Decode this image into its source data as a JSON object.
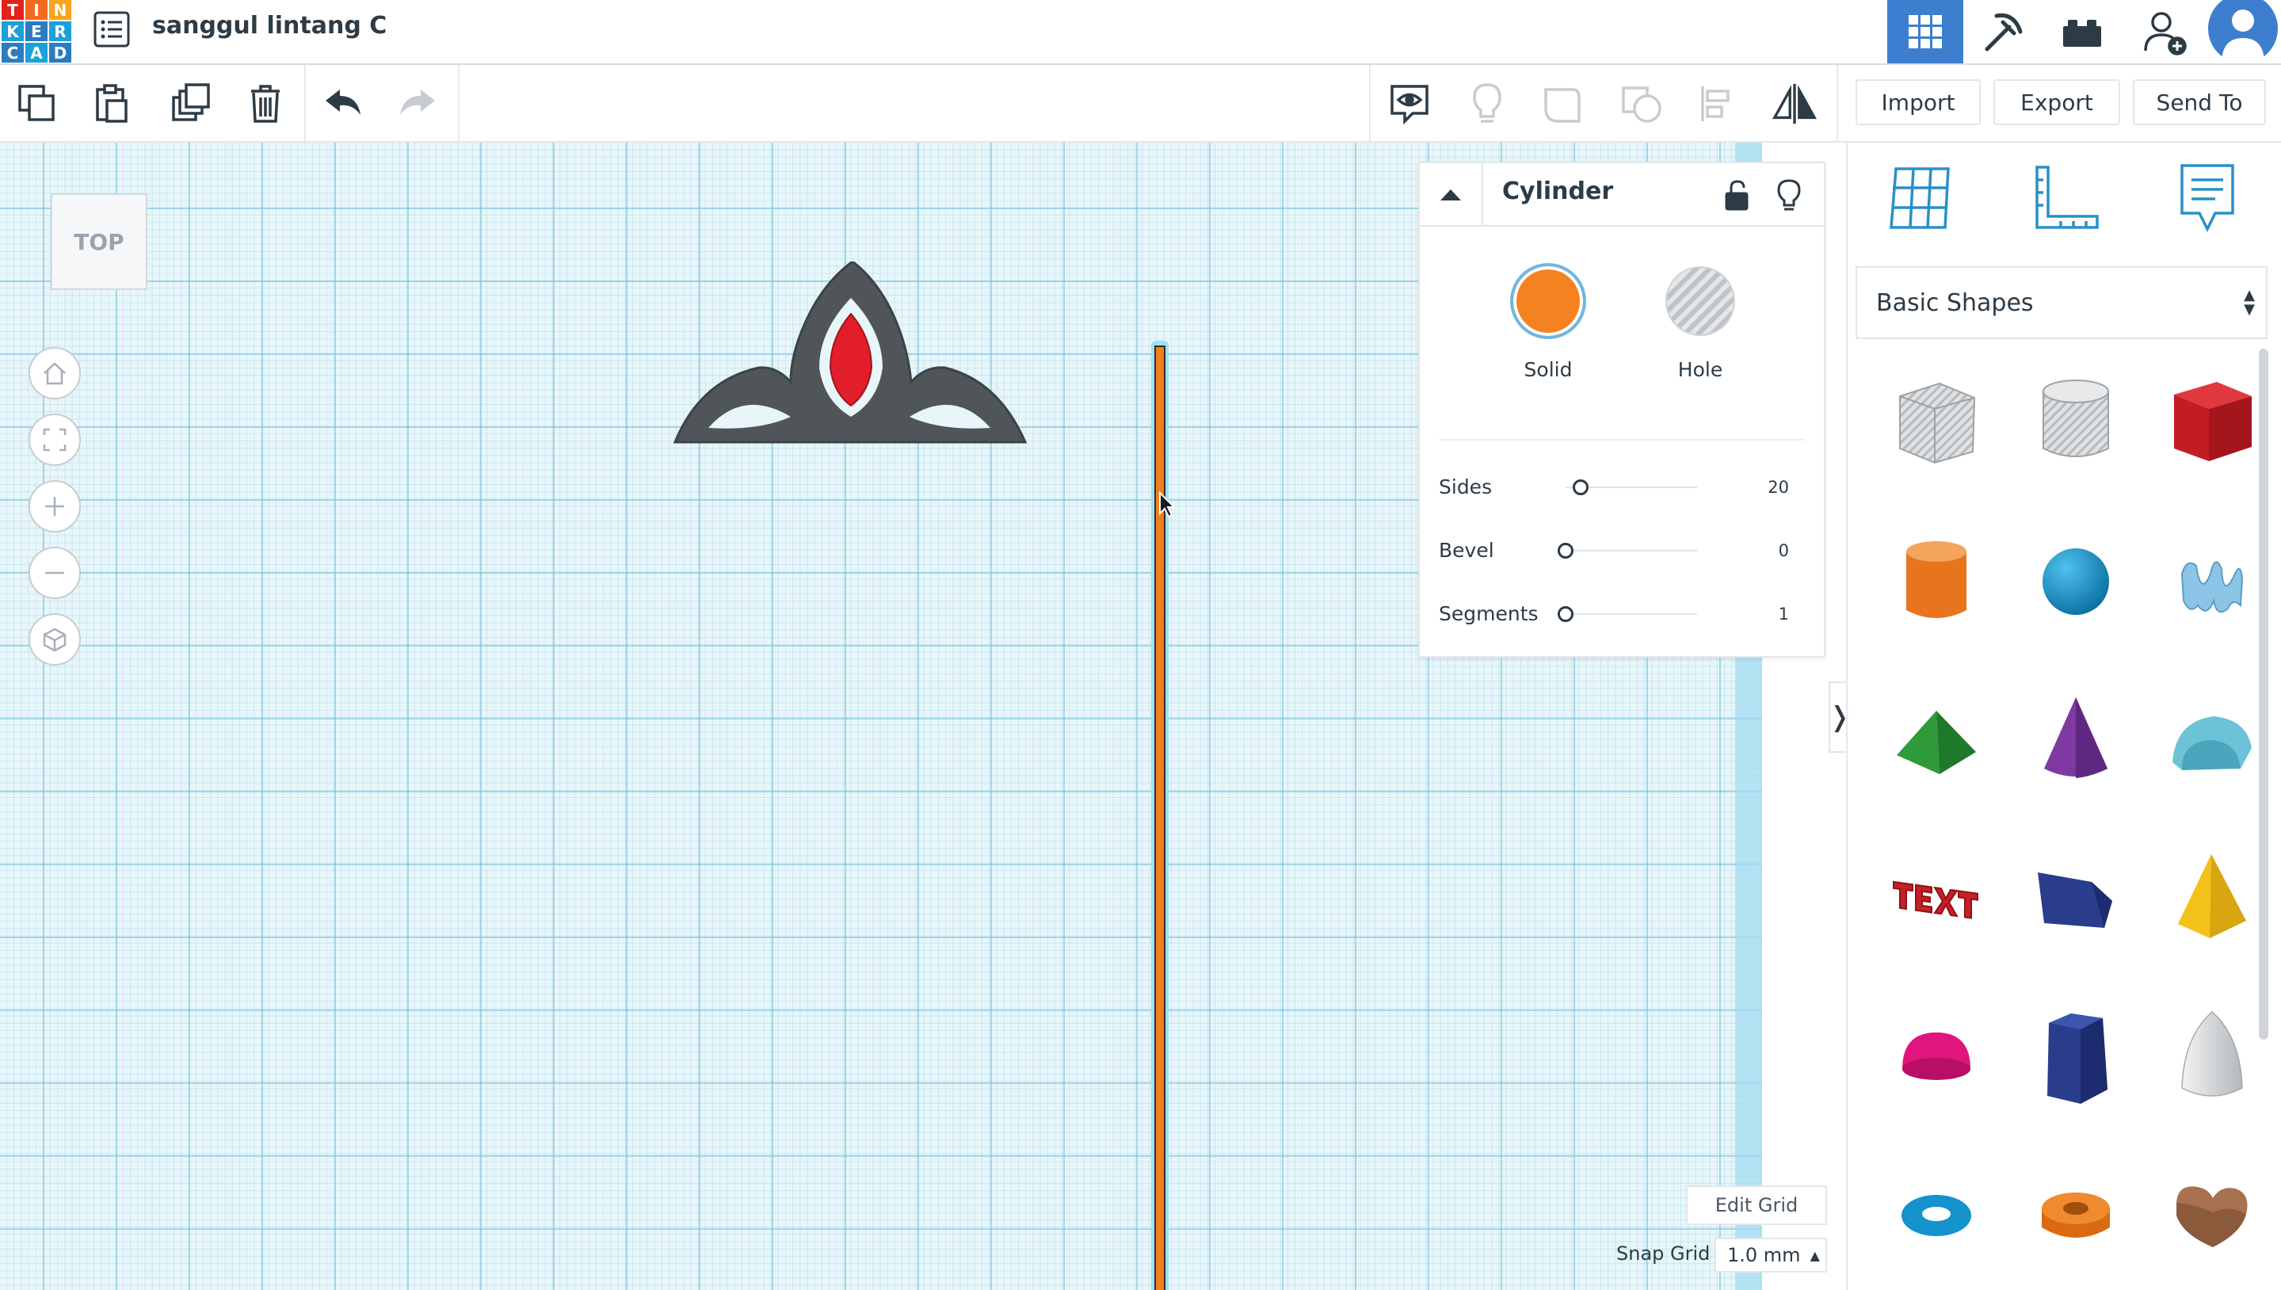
{
  "app": {
    "logo_letters": [
      "T",
      "I",
      "N",
      "K",
      "E",
      "R",
      "C",
      "A",
      "D"
    ],
    "logo_colors": [
      "#e2231a",
      "#f26b21",
      "#f8a51b",
      "#1aa1d8",
      "#1aa1d8",
      "#1aa1d8",
      "#1aa1d8",
      "#1aa1d8",
      "#1aa1d8"
    ],
    "design_title": "sanggul lintang C"
  },
  "top_right": {
    "buttons": [
      "grid-view-icon",
      "pickaxe-icon",
      "bricks-icon",
      "add-user-icon",
      "avatar"
    ]
  },
  "toolbar": {
    "left_tools": [
      "copy-icon",
      "paste-icon",
      "duplicate-icon",
      "delete-icon",
      "undo-icon",
      "redo-icon"
    ],
    "right_tools": [
      "notes-visibility-icon",
      "light-bulb-icon",
      "group-icon",
      "ungroup-icon",
      "align-icon",
      "mirror-icon"
    ],
    "import_label": "Import",
    "export_label": "Export",
    "send_to_label": "Send To"
  },
  "workplane": {
    "viewcube_label": "TOP",
    "nav_buttons": [
      "home-icon",
      "fit-view-icon",
      "zoom-in-icon",
      "zoom-out-icon",
      "perspective-icon"
    ],
    "edit_grid_label": "Edit Grid",
    "snap_grid_label": "Snap Grid",
    "snap_grid_value": "1.0 mm",
    "colors": {
      "grid_bg": "#e8f6fa",
      "crown": "#4f5558",
      "gem": "#e21e2b",
      "cylinder": "#f07f22",
      "selection": "#3cc6ee"
    }
  },
  "inspector": {
    "title": "Cylinder",
    "solid_label": "Solid",
    "hole_label": "Hole",
    "solid_color": "#f58220",
    "properties": [
      {
        "label": "Sides",
        "value": "20",
        "fraction": 0.08
      },
      {
        "label": "Bevel",
        "value": "0",
        "fraction": 0.0
      },
      {
        "label": "Segments",
        "value": "1",
        "fraction": 0.0
      }
    ]
  },
  "shape_panel": {
    "view_buttons": [
      "workplane-icon",
      "ruler-icon",
      "notes-icon"
    ],
    "category": "Basic Shapes",
    "shapes": [
      {
        "name": "box-hole",
        "color": "#c9ccd0"
      },
      {
        "name": "cylinder-hole",
        "color": "#c9ccd0"
      },
      {
        "name": "box",
        "color": "#d3202a"
      },
      {
        "name": "cylinder",
        "color": "#f07f22"
      },
      {
        "name": "sphere",
        "color": "#1493cc"
      },
      {
        "name": "scribble",
        "color": "#8cc4e6"
      },
      {
        "name": "roof",
        "color": "#2e9a3a"
      },
      {
        "name": "cone",
        "color": "#7e3aa0"
      },
      {
        "name": "round-roof",
        "color": "#6cc3d8"
      },
      {
        "name": "text",
        "color": "#c81e26"
      },
      {
        "name": "wedge",
        "color": "#2a3d8c"
      },
      {
        "name": "pyramid",
        "color": "#f2c21b"
      },
      {
        "name": "half-sphere",
        "color": "#e0157e"
      },
      {
        "name": "polygon",
        "color": "#2a3d8c"
      },
      {
        "name": "paraboloid",
        "color": "#d8dadc"
      },
      {
        "name": "torus",
        "color": "#1493cc"
      },
      {
        "name": "tube",
        "color": "#f07f22"
      },
      {
        "name": "heart",
        "color": "#8a5a3a"
      }
    ]
  }
}
